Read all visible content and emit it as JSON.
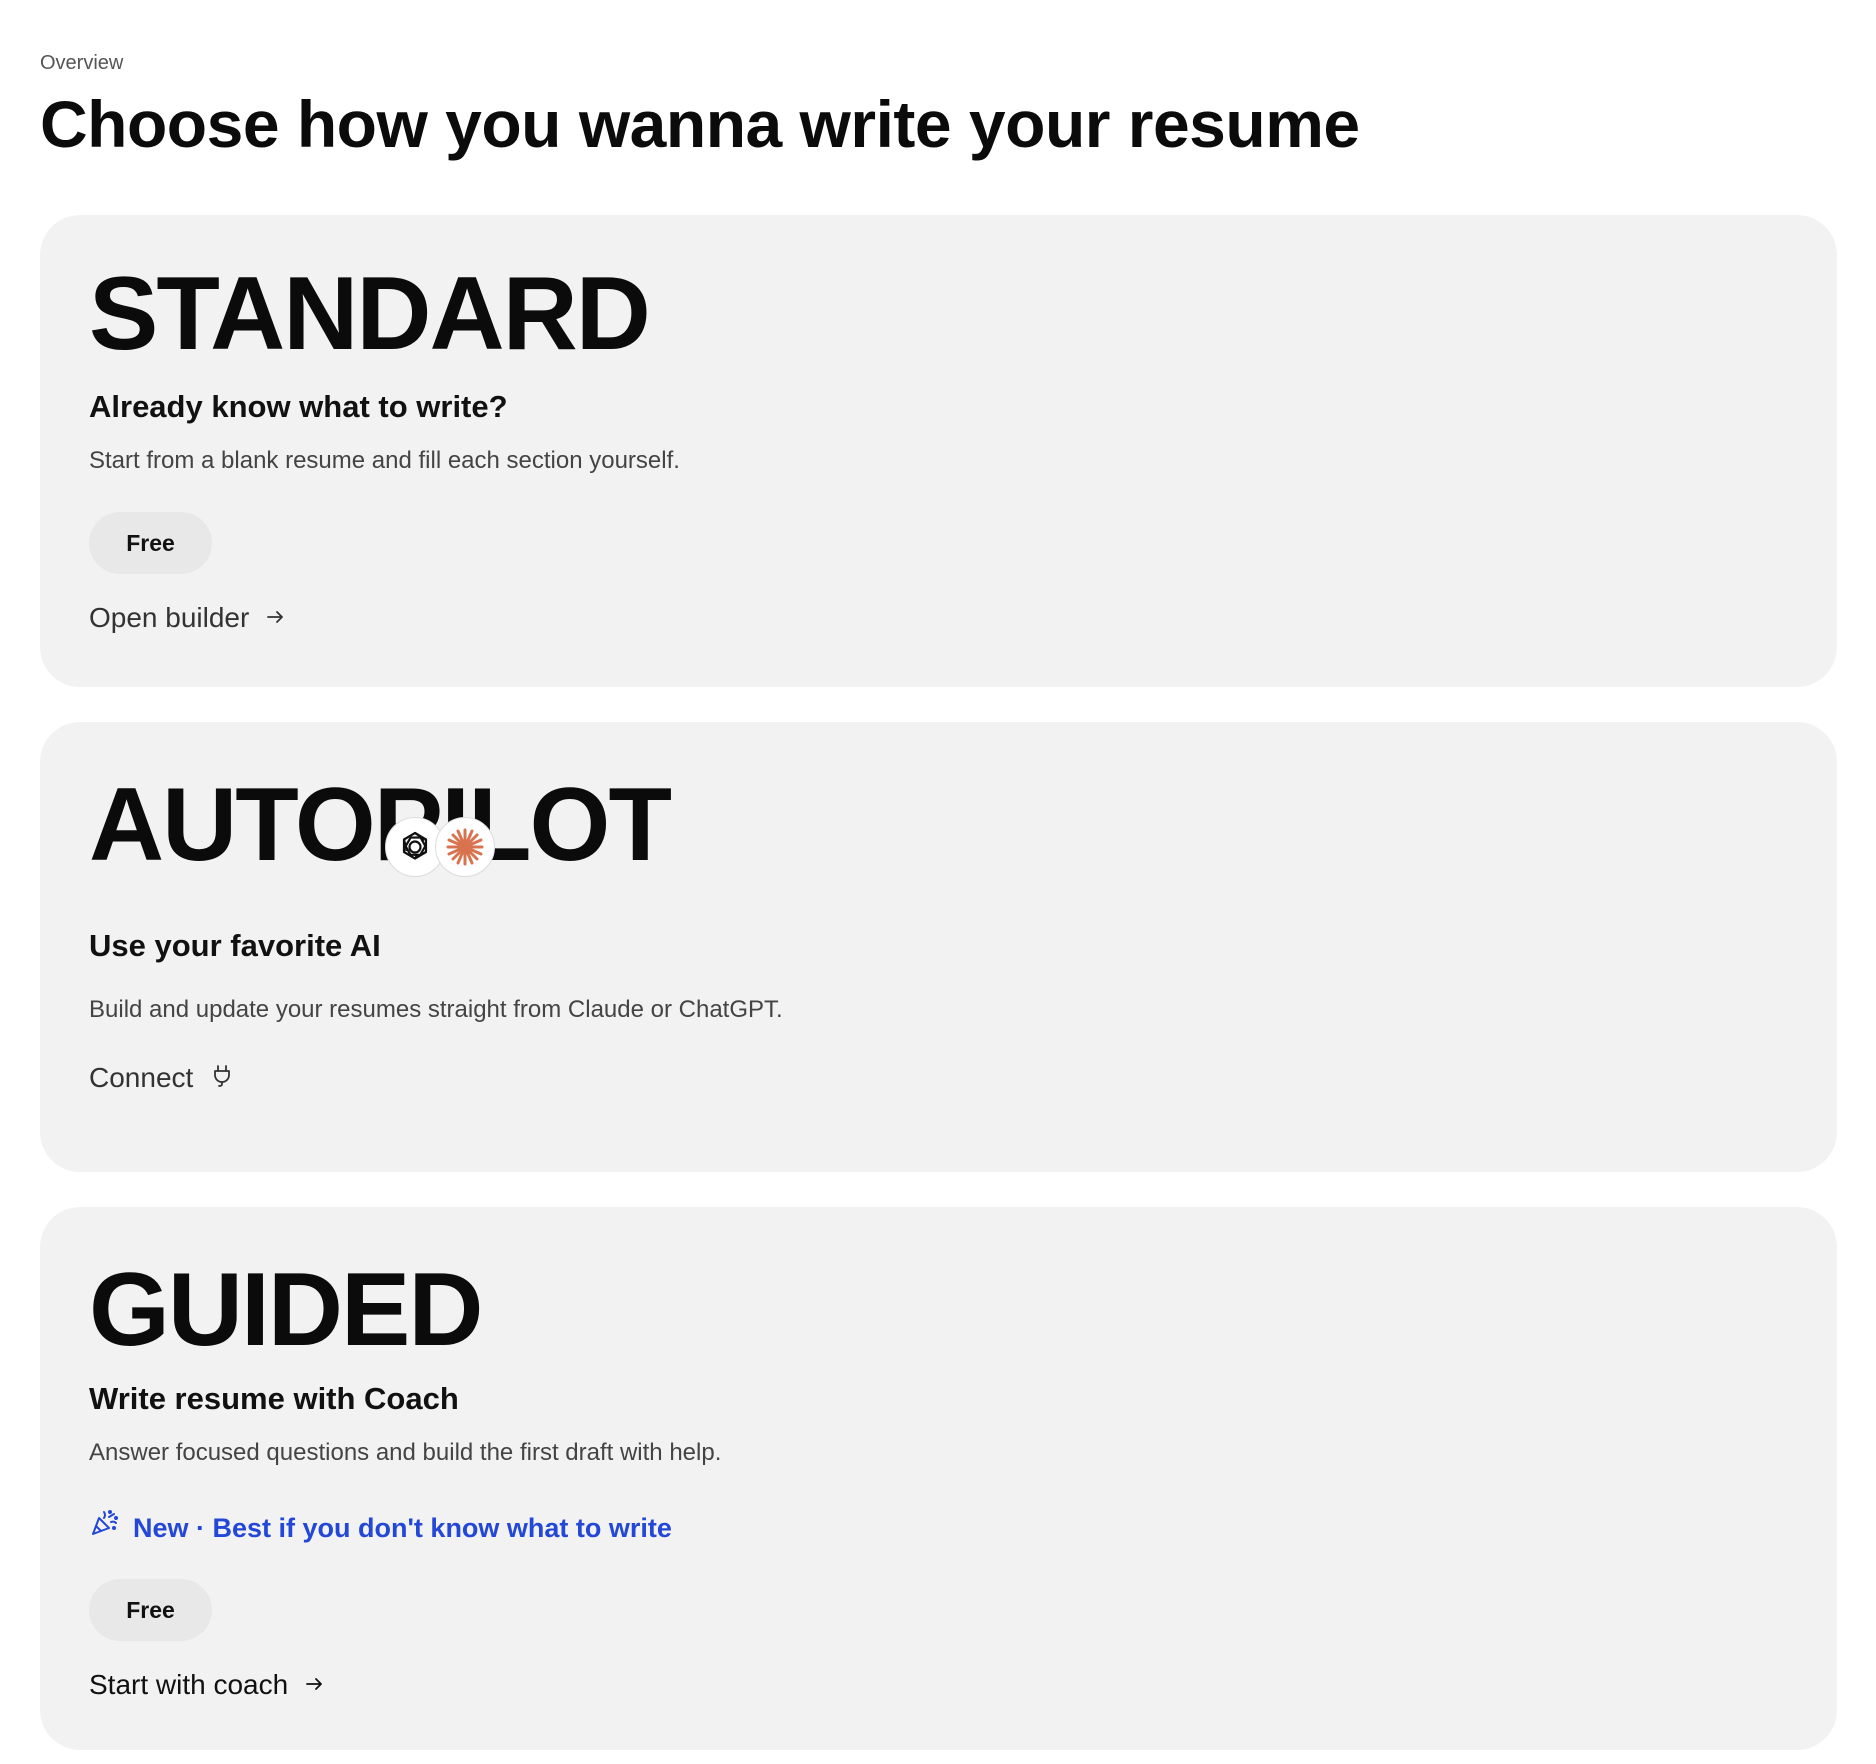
{
  "header": {
    "breadcrumb": "Overview",
    "title": "Choose how you wanna write your resume"
  },
  "cards": {
    "standard": {
      "mode": "STANDARD",
      "subtitle": "Already know what to write?",
      "description": "Start from a blank resume and fill each section yourself.",
      "price_badge": "Free",
      "action_label": "Open builder",
      "action_icon": "arrow-right-icon"
    },
    "autopilot": {
      "mode": "AUTOPILOT",
      "subtitle": "Use your favorite AI",
      "ai_icons": [
        "chatgpt-logo-icon",
        "claude-logo-icon"
      ],
      "description": "Build and update your resumes straight from Claude or ChatGPT.",
      "action_label": "Connect",
      "action_icon": "plug-icon"
    },
    "guided": {
      "mode": "GUIDED",
      "subtitle": "Write resume with Coach",
      "description": "Answer focused questions and build the first draft with help.",
      "tag_label": "New · Best if you don't know what to write",
      "tag_icon": "party-popper-icon",
      "price_badge": "Free",
      "action_label": "Start with coach",
      "action_icon": "arrow-right-icon"
    }
  },
  "colors": {
    "card_background": "#f2f2f2",
    "pill_background": "#e8e8e8",
    "accent_blue": "#2347d6",
    "claude_orange": "#d9734f",
    "text_primary": "#111111"
  }
}
